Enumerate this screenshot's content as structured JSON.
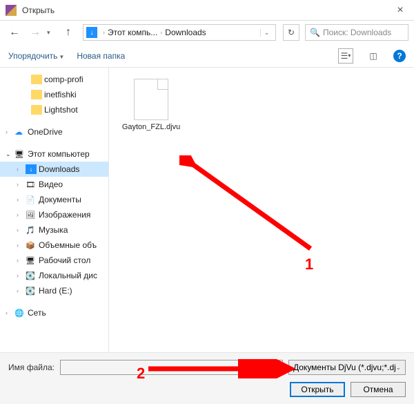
{
  "title": "Открыть",
  "close": "×",
  "nav": {
    "back": "←",
    "fwd": "→",
    "up": "↑",
    "refresh": "↻"
  },
  "path": {
    "seg1": "Этот компь...",
    "seg2": "Downloads"
  },
  "search": {
    "placeholder": "Поиск: Downloads"
  },
  "toolbar": {
    "organize": "Упорядочить",
    "newfolder": "Новая папка"
  },
  "tree": {
    "compprofi": "comp-profi",
    "inetfishki": "inetfishki",
    "lightshot": "Lightshot",
    "onedrive": "OneDrive",
    "thispc": "Этот компьютер",
    "downloads": "Downloads",
    "video": "Видео",
    "docs": "Документы",
    "images": "Изображения",
    "music": "Музыка",
    "volumes": "Объемные объ",
    "desktop": "Рабочий стол",
    "localdisk": "Локальный дис",
    "hard": "Hard (E:)",
    "network": "Сеть"
  },
  "file": {
    "name": "Gayton_FZL.djvu"
  },
  "footer": {
    "filename_label": "Имя файла:",
    "filetype": "Документы DjVu (*.djvu;*.djv)",
    "open": "Открыть",
    "cancel": "Отмена"
  },
  "annotations": {
    "n1": "1",
    "n2": "2"
  }
}
